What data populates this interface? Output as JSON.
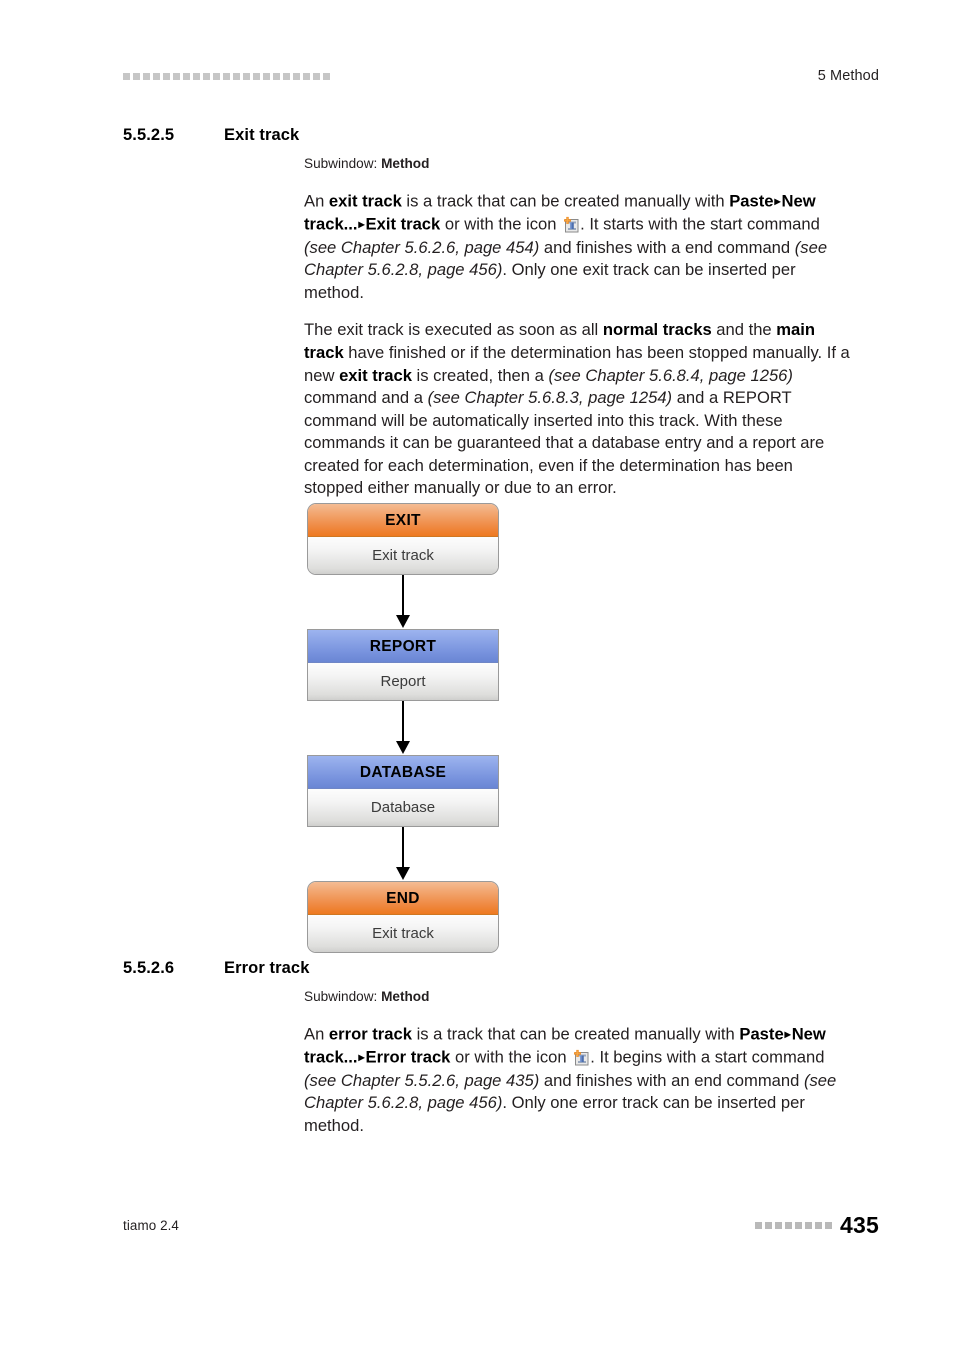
{
  "header": {
    "marker_count": 21,
    "chapter_title": "5 Method"
  },
  "footer": {
    "product": "tiamo 2.4",
    "marker_count": 8,
    "page_number": "435"
  },
  "sections": [
    {
      "number": "5.5.2.5",
      "title": "Exit track",
      "subwindow_label": "Subwindow:",
      "subwindow_value": "Method"
    },
    {
      "number": "5.5.2.6",
      "title": "Error track",
      "subwindow_label": "Subwindow:",
      "subwindow_value": "Method"
    }
  ],
  "exit_track": {
    "paragraph1": {
      "t1": "An ",
      "b1": "exit track",
      "t2": " is a track that can be created manually with ",
      "b2": "Paste",
      "sep1": "▸",
      "b3": "New track...",
      "sep2": "▸",
      "b4": "Exit track",
      "t3": " or with the icon ",
      "t4": ". It starts with the start command ",
      "i1": "(see Chapter 5.6.2.6, page 454)",
      "t5": " and finishes with a end command ",
      "i2": "(see Chapter 5.6.2.8, page 456)",
      "t6": ". Only one exit track can be inserted per method."
    },
    "paragraph2": {
      "t1": "The exit track is executed as soon as all ",
      "b1": "normal tracks",
      "t2": " and the ",
      "b2": "main track",
      "t3": " have finished or if the determination has been stopped manually. If a new ",
      "b3": "exit track",
      "t4": " is created, then a ",
      "i1": "(see Chapter 5.6.8.4, page 1256)",
      "t5": " command and a ",
      "i2": "(see Chapter 5.6.8.3, page 1254)",
      "t6": " and a REPORT command will be automatically inserted into this track. With these commands it can be guaranteed that a database entry and a report are created for each determination, even if the determination has been stopped either manually or due to an error."
    }
  },
  "error_track": {
    "paragraph1": {
      "t1": "An ",
      "b1": "error track",
      "t2": " is a track that can be created manually with ",
      "b2": "Paste",
      "sep1": "▸",
      "b3": "New track...",
      "sep2": "▸",
      "b4": "Error track",
      "t3": " or with the icon ",
      "t4": ". It begins with a start command ",
      "i1": "(see Chapter 5.5.2.6, page 435)",
      "t5": " and finishes with an end command ",
      "i2": "(see Chapter 5.6.2.8, page 456)",
      "t6": ". Only one error track can be inserted per method."
    }
  },
  "diagram": {
    "nodes": [
      {
        "header": "EXIT",
        "body": "Exit track",
        "header_color": "#ee7920",
        "shape": "round"
      },
      {
        "header": "REPORT",
        "body": "Report",
        "header_color": "#7590dc",
        "shape": "square"
      },
      {
        "header": "DATABASE",
        "body": "Database",
        "header_color": "#7590dc",
        "shape": "square"
      },
      {
        "header": "END",
        "body": "Exit track",
        "header_color": "#ee7920",
        "shape": "round"
      }
    ]
  },
  "icons": {
    "new_track_icon": "new-track-icon"
  }
}
